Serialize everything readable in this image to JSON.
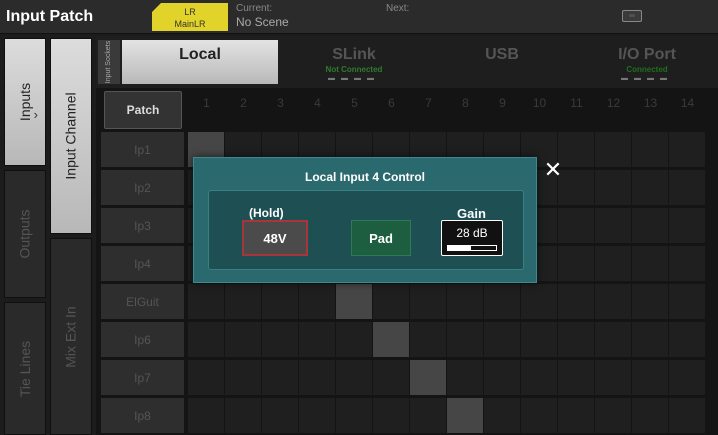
{
  "header": {
    "title": "Input Patch",
    "mix_line1": "LR",
    "mix_line2": "MainLR",
    "current_label": "Current:",
    "current_scene": "No Scene",
    "next_label": "Next:"
  },
  "nav": {
    "inputs": "Inputs",
    "outputs": "Outputs",
    "tie_lines": "Tie Lines",
    "input_channel": "Input Channel",
    "mix_ext_in": "Mix Ext In"
  },
  "sources": {
    "sockets_label": "Input Sockets",
    "local": "Local",
    "slink": "SLink",
    "slink_status": "Not Connected",
    "usb": "USB",
    "io_port": "I/O Port",
    "io_status": "Connected"
  },
  "grid": {
    "patch_label": "Patch",
    "columns": [
      "1",
      "2",
      "3",
      "4",
      "5",
      "6",
      "7",
      "8",
      "9",
      "10",
      "11",
      "12",
      "13",
      "14"
    ],
    "rows": [
      "Ip1",
      "Ip2",
      "Ip3",
      "Ip4",
      "ElGuit",
      "Ip6",
      "Ip7",
      "Ip8"
    ],
    "patched_column_for_row": [
      1,
      2,
      3,
      4,
      5,
      6,
      7,
      8
    ]
  },
  "modal": {
    "title": "Local Input 4 Control",
    "hold_label": "(Hold)",
    "phantom_label": "48V",
    "pad_label": "Pad",
    "gain_label": "Gain",
    "gain_value": "28 dB",
    "gain_fraction": 0.48
  },
  "colors": {
    "accent_yellow": "#e2d32a",
    "modal_teal": "#2a6a6f",
    "phantom_red": "#a8353a",
    "pad_green": "#1e5e40"
  }
}
